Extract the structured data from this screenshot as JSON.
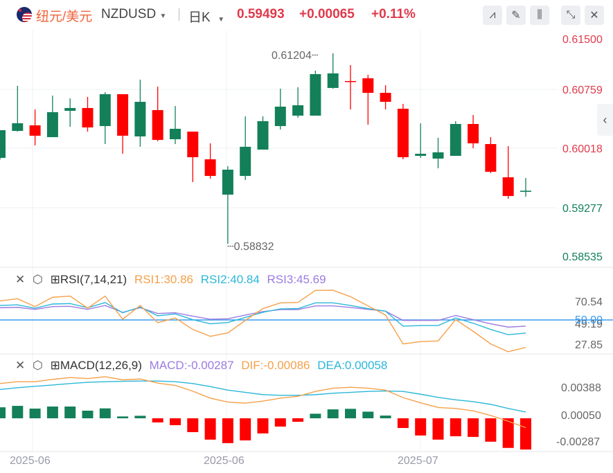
{
  "header": {
    "pair_cn": "纽元/美元",
    "symbol": "NZDUSD",
    "period": "日K",
    "price": "0.59493",
    "change": "+0.00065",
    "change_pct": "+0.11%"
  },
  "toolbar": {
    "icons": [
      "indicator-icon",
      "draw-icon",
      "candle-type-icon",
      "collapse-icon",
      "close-icon"
    ]
  },
  "price_axis": [
    "0.61500",
    "0.60759",
    "0.60018",
    "0.59277",
    "0.58535"
  ],
  "annotations": {
    "high": "0.61204",
    "low": "0.58832"
  },
  "date_axis": [
    "2025-06",
    "2025-06",
    "2025-07"
  ],
  "colors": {
    "up": "#13805a",
    "down": "#ff0000",
    "rsi1": "#f5a04a",
    "rsi2": "#2bb7d8",
    "rsi3": "#9b7be0",
    "mid": "#3a9bef"
  },
  "candles": [
    [
      0.59902,
      0.60247,
      0.5988,
      0.60247
    ],
    [
      0.60238,
      0.60799,
      0.60229,
      0.60333
    ],
    [
      0.60307,
      0.60505,
      0.60057,
      0.60178
    ],
    [
      0.6016,
      0.60678,
      0.6016,
      0.60471
    ],
    [
      0.60488,
      0.60643,
      0.6029,
      0.60523
    ],
    [
      0.60523,
      0.60661,
      0.60229,
      0.60281
    ],
    [
      0.60298,
      0.6072,
      0.60074,
      0.60695
    ],
    [
      0.60695,
      0.60695,
      0.59953,
      0.60178
    ],
    [
      0.60169,
      0.60876,
      0.6004,
      0.606
    ],
    [
      0.60497,
      0.6079,
      0.60109,
      0.60126
    ],
    [
      0.60134,
      0.60548,
      0.60074,
      0.60264
    ],
    [
      0.60229,
      0.60229,
      0.596,
      0.5991
    ],
    [
      0.59884,
      0.60083,
      0.59643,
      0.59677
    ],
    [
      0.59444,
      0.59798,
      0.58832,
      0.59755
    ],
    [
      0.59677,
      0.60419,
      0.59626,
      0.6004
    ],
    [
      0.60005,
      0.60419,
      0.60005,
      0.60359
    ],
    [
      0.60298,
      0.60764,
      0.60255,
      0.6054
    ],
    [
      0.60428,
      0.60781,
      0.60402,
      0.60557
    ],
    [
      0.60428,
      0.60988,
      0.60428,
      0.60945
    ],
    [
      0.60773,
      0.61204,
      0.60764,
      0.60954
    ],
    [
      0.60859,
      0.61057,
      0.60505,
      0.6085
    ],
    [
      0.60893,
      0.60937,
      0.60316,
      0.60712
    ],
    [
      0.60712,
      0.60807,
      0.60505,
      0.606
    ],
    [
      0.60514,
      0.60574,
      0.59884,
      0.5991
    ],
    [
      0.59927,
      0.60333,
      0.59902,
      0.59953
    ],
    [
      0.59893,
      0.60152,
      0.59772,
      0.59971
    ],
    [
      0.59927,
      0.60359,
      0.59927,
      0.60324
    ],
    [
      0.60324,
      0.60436,
      0.60022,
      0.60083
    ],
    [
      0.60074,
      0.6016,
      0.59712,
      0.59729
    ],
    [
      0.5966,
      0.60048,
      0.59393,
      0.59427
    ],
    [
      0.59479,
      0.59651,
      0.59419,
      0.59493
    ]
  ],
  "rsi": {
    "title": "RSI(7,14,21)",
    "rsi1_label": "RSI1:30.86",
    "rsi2_label": "RSI2:40.84",
    "rsi3_label": "RSI3:45.69",
    "axis": {
      "max": "70.54",
      "mid": "50.00",
      "cur": "49.19",
      "min": "27.85"
    },
    "rsi1": [
      63.3,
      64.8,
      59.3,
      65.8,
      66.6,
      58.2,
      66.6,
      50.5,
      60.1,
      48.1,
      51.4,
      43.4,
      38.6,
      41.0,
      49.7,
      57.9,
      61.9,
      62.2,
      70.6,
      70.7,
      66.2,
      59.8,
      53.4,
      33.3,
      34.9,
      35.4,
      50.2,
      42.1,
      33.3,
      27.85,
      30.86
    ],
    "rsi2": [
      60.1,
      60.5,
      58.2,
      61.1,
      61.4,
      58.5,
      62.1,
      55.0,
      59.0,
      52.9,
      54.2,
      50.2,
      47.3,
      48.2,
      51.8,
      55.3,
      57.7,
      57.9,
      61.9,
      61.9,
      60.1,
      57.9,
      56.1,
      45.7,
      46.1,
      46.1,
      51.4,
      47.7,
      43.4,
      39.7,
      40.84
    ],
    "rsi3": [
      58.5,
      58.8,
      57.4,
      59.3,
      59.5,
      57.4,
      60.1,
      55.3,
      58.5,
      54.5,
      55.0,
      52.6,
      50.5,
      50.8,
      53.4,
      55.8,
      57.2,
      57.2,
      59.8,
      59.8,
      58.7,
      57.4,
      56.1,
      49.7,
      49.7,
      49.7,
      53.1,
      50.2,
      47.3,
      45.0,
      45.69
    ]
  },
  "macd": {
    "title": "MACD(12,26,9)",
    "macd_label": "MACD:-0.00287",
    "dif_label": "DIF:-0.00086",
    "dea_label": "DEA:0.00058",
    "axis": [
      "0.00388",
      "0.00050",
      "-0.00287"
    ],
    "hist": [
      0.00101,
      0.00114,
      0.00089,
      0.00108,
      0.00108,
      0.0007,
      0.00091,
      0.00017,
      0.00023,
      -0.00038,
      -0.00063,
      -0.00127,
      -0.00196,
      -0.00228,
      -0.00203,
      -0.00139,
      -0.00076,
      -0.00032,
      0.00042,
      0.00082,
      0.00087,
      0.00061,
      0.00025,
      -0.00089,
      -0.00158,
      -0.00196,
      -0.00165,
      -0.00171,
      -0.00215,
      -0.00272,
      -0.00287
    ],
    "dif": [
      0.00319,
      0.00336,
      0.00336,
      0.00357,
      0.00374,
      0.00365,
      0.00382,
      0.00353,
      0.00361,
      0.00323,
      0.00302,
      0.00249,
      0.00185,
      0.00149,
      0.00139,
      0.00158,
      0.00185,
      0.00202,
      0.00247,
      0.00276,
      0.00285,
      0.00276,
      0.00259,
      0.0019,
      0.00143,
      0.00099,
      0.0009,
      0.00069,
      0.00026,
      -0.00027,
      -0.00086
    ],
    "dea": [
      0.00264,
      0.00281,
      0.00294,
      0.00306,
      0.00319,
      0.0033,
      0.00336,
      0.0034,
      0.00342,
      0.00342,
      0.00336,
      0.00319,
      0.00291,
      0.00259,
      0.00238,
      0.00217,
      0.00211,
      0.00211,
      0.00217,
      0.0023,
      0.00238,
      0.00247,
      0.00251,
      0.00247,
      0.00221,
      0.00192,
      0.0017,
      0.00153,
      0.00128,
      0.0009,
      0.00058
    ]
  }
}
